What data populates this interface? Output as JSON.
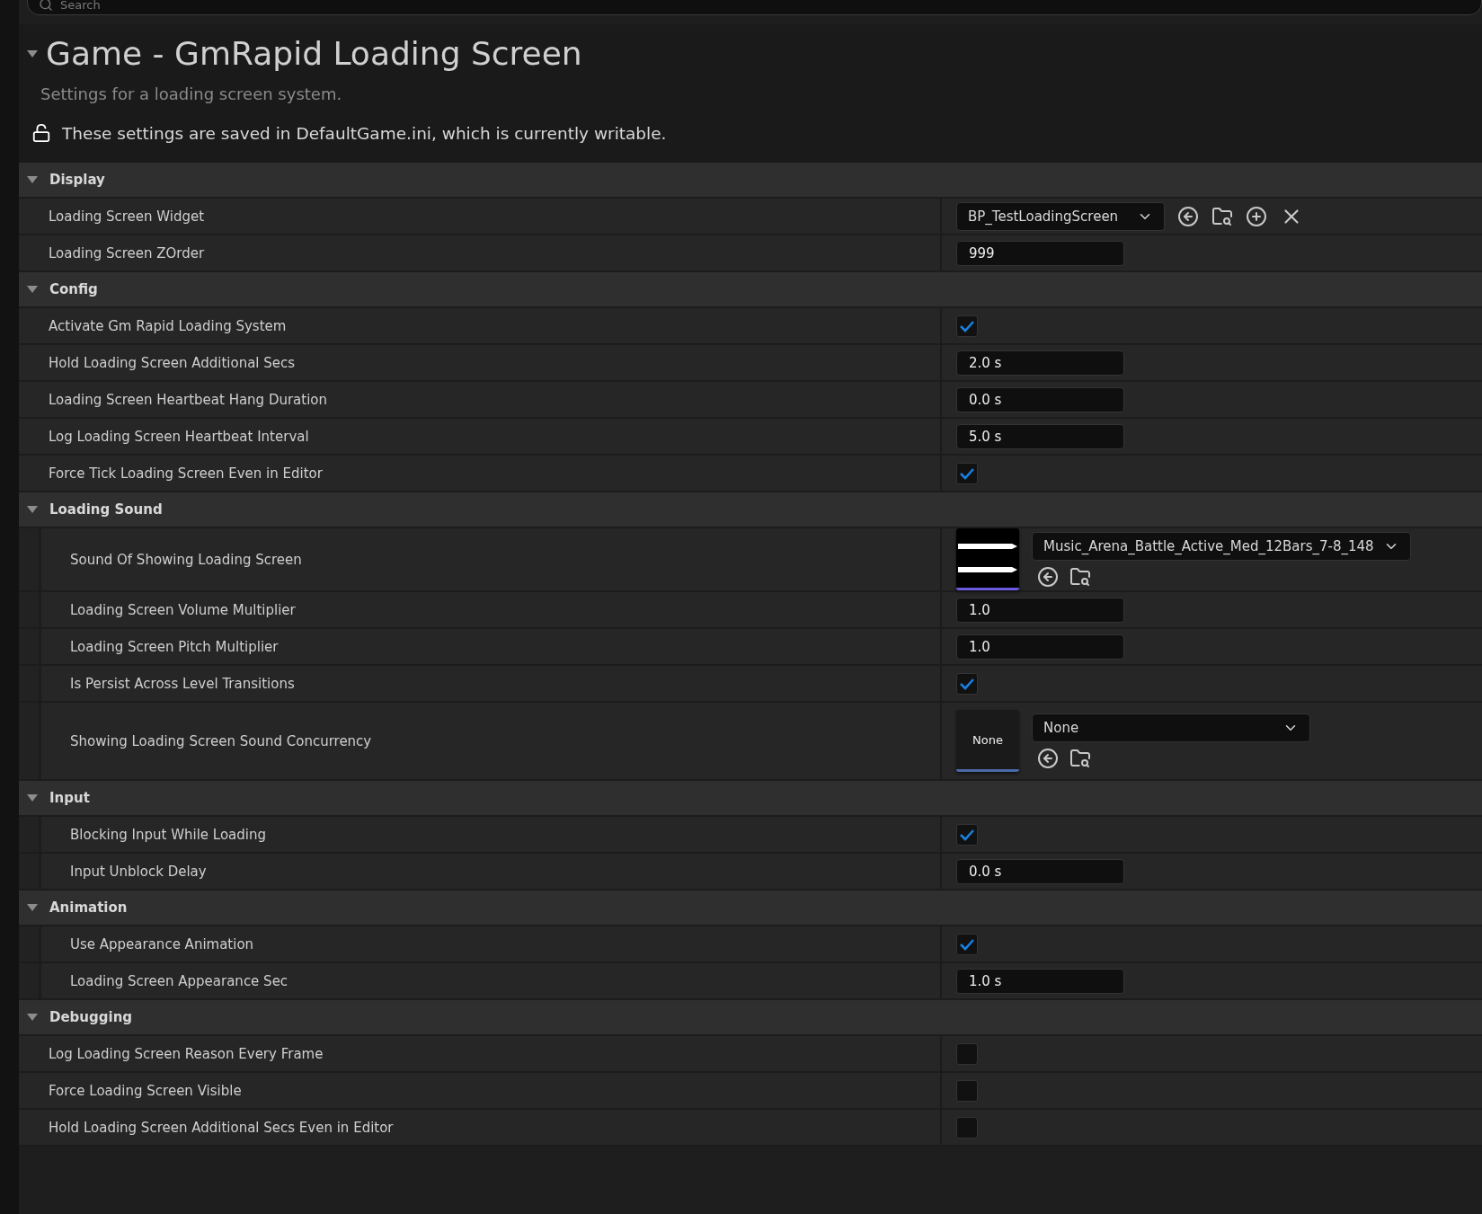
{
  "search": {
    "placeholder": "Search"
  },
  "header": {
    "title": "Game - GmRapid Loading Screen",
    "expanded": true,
    "description": "Settings for a loading screen system.",
    "notice": "These settings are saved in DefaultGame.ini, which is currently writable."
  },
  "sections": [
    {
      "title": "Display",
      "expanded": true,
      "nested": false,
      "rows": [
        {
          "label": "Loading Screen Widget",
          "kind": "class-picker",
          "value": "BP_TestLoadingScreen"
        },
        {
          "label": "Loading Screen ZOrder",
          "kind": "number",
          "value": "999"
        }
      ]
    },
    {
      "title": "Config",
      "expanded": true,
      "nested": false,
      "rows": [
        {
          "label": "Activate Gm Rapid Loading System",
          "kind": "checkbox",
          "checked": true
        },
        {
          "label": "Hold Loading Screen Additional Secs",
          "kind": "number",
          "value": "2.0 s"
        },
        {
          "label": "Loading Screen Heartbeat Hang Duration",
          "kind": "number",
          "value": "0.0 s"
        },
        {
          "label": "Log Loading Screen Heartbeat Interval",
          "kind": "number",
          "value": "5.0 s"
        },
        {
          "label": "Force Tick Loading Screen Even in Editor",
          "kind": "checkbox",
          "checked": true
        }
      ]
    },
    {
      "title": "Loading Sound",
      "expanded": true,
      "nested": true,
      "rows": [
        {
          "label": "Sound Of Showing Loading Screen",
          "kind": "sound-picker",
          "value": "Music_Arena_Battle_Active_Med_12Bars_7-8_148"
        },
        {
          "label": "Loading Screen Volume Multiplier",
          "kind": "number",
          "value": "1.0"
        },
        {
          "label": "Loading Screen Pitch Multiplier",
          "kind": "number",
          "value": "1.0"
        },
        {
          "label": "Is Persist Across Level Transitions",
          "kind": "checkbox",
          "checked": true
        },
        {
          "label": "Showing Loading Screen Sound Concurrency",
          "kind": "asset-picker",
          "thumb_text": "None",
          "value": "None"
        }
      ]
    },
    {
      "title": "Input",
      "expanded": true,
      "nested": true,
      "rows": [
        {
          "label": "Blocking Input While Loading",
          "kind": "checkbox",
          "checked": true
        },
        {
          "label": "Input Unblock Delay",
          "kind": "number",
          "value": "0.0 s"
        }
      ]
    },
    {
      "title": "Animation",
      "expanded": true,
      "nested": true,
      "rows": [
        {
          "label": "Use Appearance Animation",
          "kind": "checkbox",
          "checked": true
        },
        {
          "label": "Loading Screen Appearance Sec",
          "kind": "number",
          "value": "1.0 s"
        }
      ]
    },
    {
      "title": "Debugging",
      "expanded": true,
      "nested": false,
      "rows": [
        {
          "label": "Log Loading Screen Reason Every Frame",
          "kind": "checkbox",
          "checked": false
        },
        {
          "label": "Force Loading Screen Visible",
          "kind": "checkbox",
          "checked": false
        },
        {
          "label": "Hold Loading Screen Additional Secs Even in Editor",
          "kind": "checkbox",
          "checked": false
        }
      ]
    }
  ]
}
